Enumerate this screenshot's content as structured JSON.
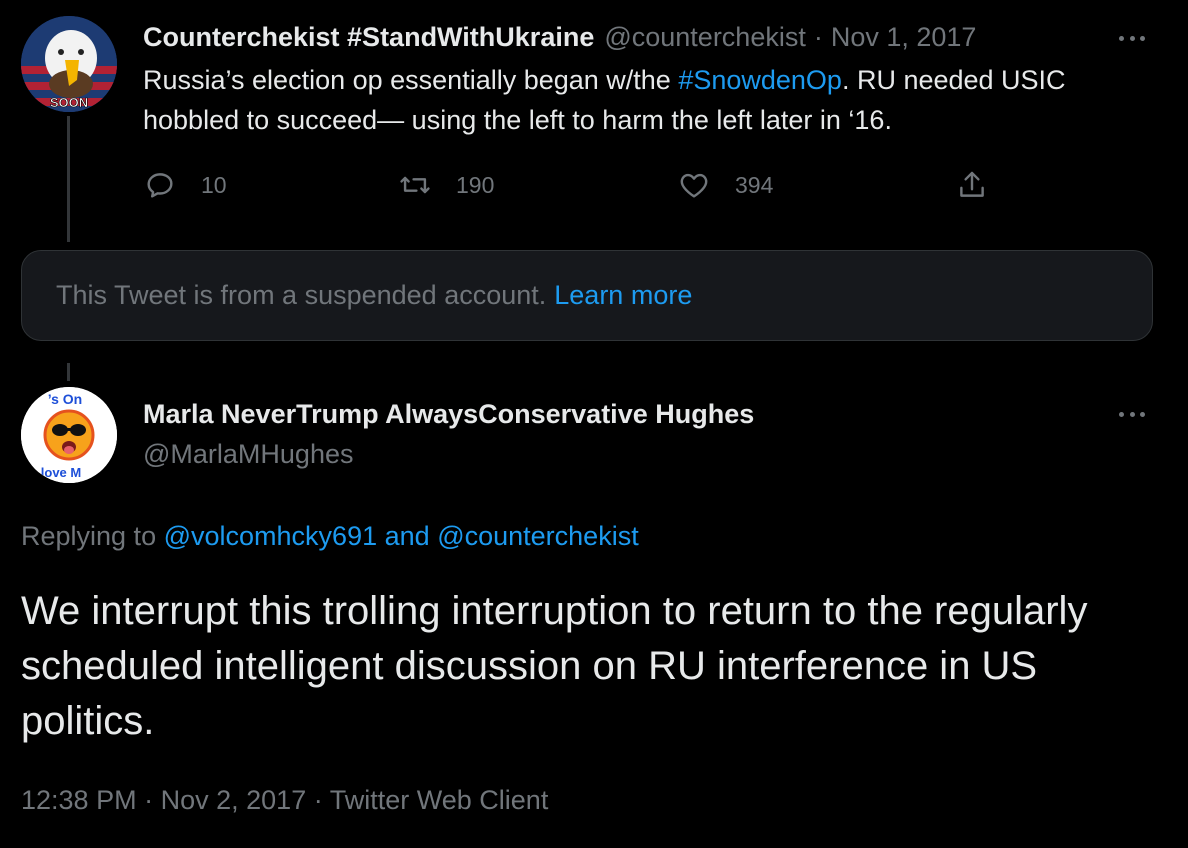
{
  "tweet1": {
    "author_name": "Counterchekist #StandWithUkraine",
    "author_handle": "@counterchekist",
    "separator": "·",
    "date": "Nov 1, 2017",
    "avatar_badge_text": "SOON",
    "text_before": "Russia’s election op essentially began w/the ",
    "hashtag": "#SnowdenOp",
    "text_after": ". RU needed USIC hobbled to succeed— using the left to harm the left later in ‘16.",
    "actions": {
      "reply_count": "10",
      "retweet_count": "190",
      "like_count": "394"
    },
    "icons": {
      "reply": "reply-icon",
      "retweet": "retweet-icon",
      "like": "heart-icon",
      "share": "share-icon",
      "more": "more-icon"
    }
  },
  "suspended_notice": {
    "message": "This Tweet is from a suspended account.",
    "link": "Learn more"
  },
  "tweet2": {
    "author_name": "Marla NeverTrump AlwaysConservative Hughes",
    "author_handle": "@MarlaMHughes",
    "avatar_text_top": "’s On",
    "avatar_text_bottom": "love M",
    "replying_prefix": "Replying to",
    "reply_mentions": [
      "@volcomhcky691",
      "and",
      "@counterchekist"
    ],
    "text": "We interrupt this trolling interruption to return to the regularly scheduled intelligent discussion on RU interference in US politics.",
    "time": "12:38 PM",
    "separator": "·",
    "date": "Nov 2, 2017",
    "client": "Twitter Web Client"
  },
  "colors": {
    "background": "#000000",
    "text": "#e7e9ea",
    "muted": "#71767b",
    "accent": "#1d9bf0",
    "card": "#16181c"
  }
}
